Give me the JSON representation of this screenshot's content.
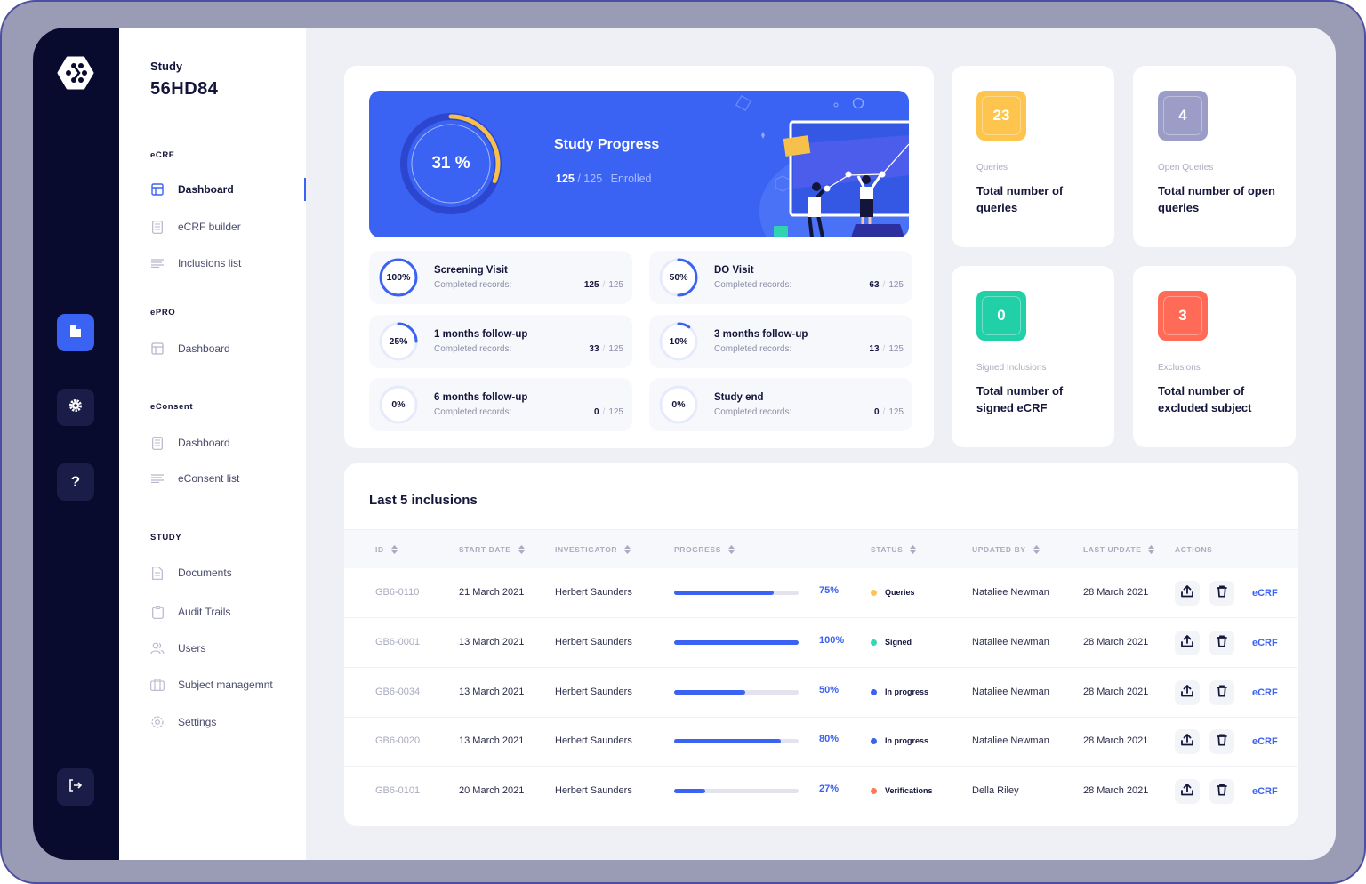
{
  "app": {
    "study_label": "Study",
    "study_id": "56HD84"
  },
  "rail": {
    "items": [
      {
        "name": "documents",
        "icon": "file-icon",
        "active": true
      },
      {
        "name": "settings",
        "icon": "gear-icon",
        "active": false
      },
      {
        "name": "help",
        "icon": "question-icon",
        "glyph": "?",
        "active": false
      },
      {
        "name": "logout",
        "icon": "logout-icon",
        "active": false
      }
    ]
  },
  "nav": {
    "sections": [
      {
        "title": "eCRF",
        "items": [
          {
            "label": "Dashboard",
            "icon": "layout-icon",
            "active": true
          },
          {
            "label": "eCRF builder",
            "icon": "form-icon"
          },
          {
            "label": "Inclusions list",
            "icon": "list-icon"
          }
        ]
      },
      {
        "title": "ePRO",
        "items": [
          {
            "label": "Dashboard",
            "icon": "layout-icon"
          }
        ]
      },
      {
        "title": "eConsent",
        "items": [
          {
            "label": "Dashboard",
            "icon": "form-icon"
          },
          {
            "label": "eConsent list",
            "icon": "list-icon"
          }
        ]
      },
      {
        "title": "STUDY",
        "items": [
          {
            "label": "Documents",
            "icon": "document-icon"
          },
          {
            "label": "Audit Trails",
            "icon": "clipboard-icon"
          },
          {
            "label": "Users",
            "icon": "users-icon"
          },
          {
            "label": "Subject managemnt",
            "icon": "briefcase-icon"
          },
          {
            "label": "Settings",
            "icon": "gear-icon"
          }
        ]
      }
    ]
  },
  "progress": {
    "percent_label": "31 %",
    "percent": 31,
    "title": "Study Progress",
    "enrolled": "125",
    "total": "125",
    "enrolled_label": "Enrolled",
    "colors": {
      "banner": "#3b63f3",
      "ring": "#f7c04a"
    }
  },
  "visits": [
    {
      "name": "Screening Visit",
      "sub": "Completed records:",
      "pct_label": "100%",
      "pct": 100,
      "done": "125",
      "total": "125"
    },
    {
      "name": "DO Visit",
      "sub": "Completed records:",
      "pct_label": "50%",
      "pct": 50,
      "done": "63",
      "total": "125"
    },
    {
      "name": "1 months follow-up",
      "sub": "Completed records:",
      "pct_label": "25%",
      "pct": 25,
      "done": "33",
      "total": "125"
    },
    {
      "name": "3 months follow-up",
      "sub": "Completed records:",
      "pct_label": "10%",
      "pct": 10,
      "done": "13",
      "total": "125"
    },
    {
      "name": "6 months follow-up",
      "sub": "Completed records:",
      "pct_label": "0%",
      "pct": 0,
      "done": "0",
      "total": "125"
    },
    {
      "name": "Study end",
      "sub": "Completed records:",
      "pct_label": "0%",
      "pct": 0,
      "done": "0",
      "total": "125"
    }
  ],
  "stats": [
    {
      "value": "23",
      "kicker": "Queries",
      "desc": "Total number of queries",
      "color": "#fdc54e"
    },
    {
      "value": "4",
      "kicker": "Open Queries",
      "desc": "Total number of open queries",
      "color": "#9c9dc6"
    },
    {
      "value": "0",
      "kicker": "Signed Inclusions",
      "desc": "Total number of signed eCRF",
      "color": "#22d0a8"
    },
    {
      "value": "3",
      "kicker": "Exclusions",
      "desc": "Total number of excluded subject",
      "color": "#ff6b57"
    }
  ],
  "table": {
    "title": "Last 5 inclusions",
    "columns": [
      "ID",
      "START DATE",
      "INVESTIGATOR",
      "PROGRESS",
      "STATUS",
      "UPDATED BY",
      "LAST UPDATE",
      "ACTIONS"
    ],
    "link_label": "eCRF",
    "rows": [
      {
        "id": "GB6-0110",
        "start": "21 March 2021",
        "investigator": "Herbert Saunders",
        "progress": 80,
        "progress_label": "75%",
        "status": "Queries",
        "status_color": "#fdc54e",
        "updated_by": "Nataliee Newman",
        "last_update": "28 March 2021"
      },
      {
        "id": "GB6-0001",
        "start": "13 March 2021",
        "investigator": "Herbert Saunders",
        "progress": 100,
        "progress_label": "100%",
        "status": "Signed",
        "status_color": "#34d6b3",
        "updated_by": "Nataliee Newman",
        "last_update": "28 March 2021"
      },
      {
        "id": "GB6-0034",
        "start": "13 March 2021",
        "investigator": "Herbert Saunders",
        "progress": 57,
        "progress_label": "50%",
        "status": "In progress",
        "status_color": "#3b63f3",
        "updated_by": "Nataliee Newman",
        "last_update": "28 March 2021"
      },
      {
        "id": "GB6-0020",
        "start": "13 March 2021",
        "investigator": "Herbert Saunders",
        "progress": 86,
        "progress_label": "80%",
        "status": "In progress",
        "status_color": "#3b63f3",
        "updated_by": "Nataliee Newman",
        "last_update": "28 March 2021"
      },
      {
        "id": "GB6-0101",
        "start": "20 March 2021",
        "investigator": "Herbert Saunders",
        "progress": 25,
        "progress_label": "27%",
        "status": "Verifications",
        "status_color": "#ff7a59",
        "updated_by": "Della Riley",
        "last_update": "28 March 2021"
      }
    ]
  }
}
